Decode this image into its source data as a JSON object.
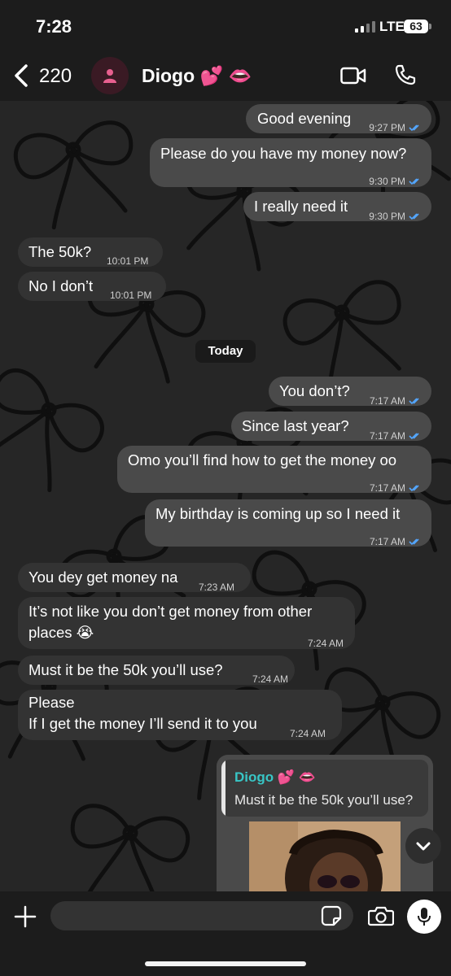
{
  "status_bar": {
    "time": "7:28",
    "network": "LTE",
    "battery": "63"
  },
  "header": {
    "back_count": "220",
    "contact_name": "Diogo 💕 👄"
  },
  "day_divider": "Today",
  "messages": [
    {
      "direction": "out",
      "text": "Good evening",
      "time": "9:27 PM",
      "read": true
    },
    {
      "direction": "out",
      "text": "Please do you have my money now?",
      "time": "9:30 PM",
      "read": true
    },
    {
      "direction": "out",
      "text": "I really need it",
      "time": "9:30 PM",
      "read": true
    },
    {
      "direction": "in",
      "text": "The 50k?",
      "time": "10:01 PM"
    },
    {
      "direction": "in",
      "text": "No I don’t",
      "time": "10:01 PM"
    },
    {
      "direction": "out",
      "text": "You don’t?",
      "time": "7:17 AM",
      "read": true
    },
    {
      "direction": "out",
      "text": "Since last year?",
      "time": "7:17 AM",
      "read": true
    },
    {
      "direction": "out",
      "text": "Omo you’ll find how to get the money oo",
      "time": "7:17 AM",
      "read": true
    },
    {
      "direction": "out",
      "text": "My birthday is coming up so I need it",
      "time": "7:17 AM",
      "read": true
    },
    {
      "direction": "in",
      "text": "You dey get money na",
      "time": "7:23 AM"
    },
    {
      "direction": "in",
      "text_lines": [
        "It’s not like you don’t get money from other",
        "places 😭"
      ],
      "time": "7:24 AM"
    },
    {
      "direction": "in",
      "text": "Must it be the 50k you’ll use?",
      "time": "7:24 AM"
    },
    {
      "direction": "in",
      "text_lines": [
        "Please",
        "If I get the money I’ll send it to you"
      ],
      "time": "7:24 AM"
    }
  ],
  "reply": {
    "quoted_name": "Diogo 💕 👄",
    "quoted_text": "Must it be the 50k you’ll use?"
  },
  "composer": {
    "placeholder": ""
  },
  "colors": {
    "read_tick": "#53a6ff",
    "quote_name": "#38c6c6",
    "out_bubble": "#4a4a4a",
    "in_bubble": "#333333"
  },
  "icons": [
    "back-chevron-icon",
    "person-icon",
    "video-call-icon",
    "phone-icon",
    "plus-icon",
    "sticker-icon",
    "camera-icon",
    "mic-icon",
    "chevron-down-icon",
    "double-check-icon"
  ]
}
